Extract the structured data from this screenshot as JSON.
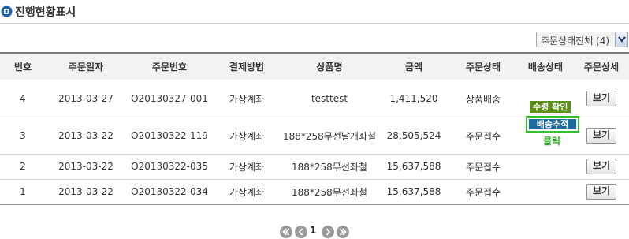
{
  "header": {
    "title": "진행현황표시"
  },
  "filter": {
    "selected": "주문상태전체 (4)"
  },
  "table": {
    "columns": [
      "번호",
      "주문일자",
      "주문번호",
      "결제방법",
      "상품명",
      "금액",
      "주문상태",
      "배송상태",
      "주문상세"
    ],
    "rows": [
      {
        "no": "4",
        "date": "2013-03-27",
        "order_no": "O20130327-001",
        "payment": "가상계좌",
        "product": "testtest",
        "amount": "1,411,520",
        "status": "상품배송",
        "detail": "보기"
      },
      {
        "no": "3",
        "date": "2013-03-22",
        "order_no": "O20130322-119",
        "payment": "가상계좌",
        "product": "188*258무선날개좌철",
        "amount": "28,505,524",
        "status": "주문접수",
        "detail": "보기"
      },
      {
        "no": "2",
        "date": "2013-03-22",
        "order_no": "O20130322-035",
        "payment": "가상계좌",
        "product": "188*258무선좌철",
        "amount": "15,637,588",
        "status": "주문접수",
        "detail": "보기"
      },
      {
        "no": "1",
        "date": "2013-03-22",
        "order_no": "O20130322-034",
        "payment": "가상계좌",
        "product": "188*258무선좌철",
        "amount": "15,637,588",
        "status": "주문접수",
        "detail": "보기"
      }
    ]
  },
  "shipping": {
    "received_label": "수령 확인",
    "track_label": "배송추적",
    "click_note": "클릭"
  },
  "pagination": {
    "current_page": "1"
  },
  "colors": {
    "title_icon": "#1f5fa8",
    "received_badge": "#5a8f1a",
    "track_button": "#1b6b9e",
    "highlight_border": "#35c030",
    "click_note": "#2fb02a"
  }
}
